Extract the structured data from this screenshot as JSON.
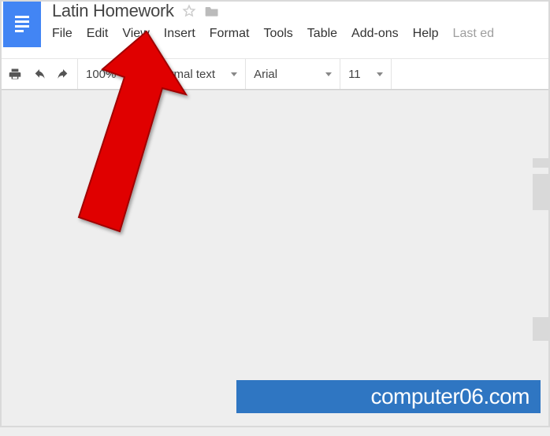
{
  "header": {
    "title": "Latin Homework",
    "starred": false
  },
  "menu": {
    "items": [
      "File",
      "Edit",
      "View",
      "Insert",
      "Format",
      "Tools",
      "Table",
      "Add-ons",
      "Help"
    ],
    "last_edit": "Last ed"
  },
  "toolbar": {
    "zoom": "100%",
    "style": "Normal text",
    "font": "Arial",
    "font_size": "11"
  },
  "watermark": {
    "text": "computer06.com"
  }
}
